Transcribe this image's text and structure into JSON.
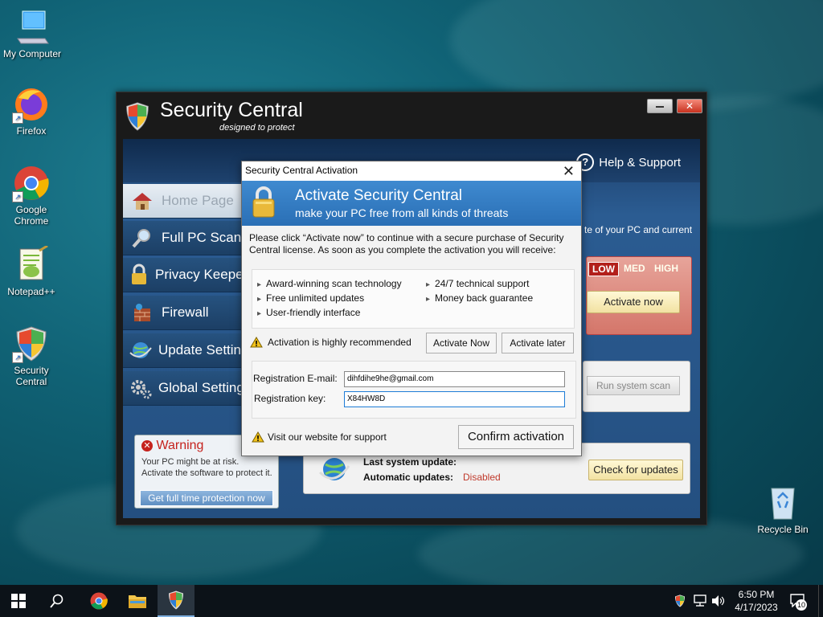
{
  "desktop": {
    "icons": [
      {
        "label": "My Computer"
      },
      {
        "label": "Firefox"
      },
      {
        "label": "Google Chrome"
      },
      {
        "label": "Notepad++"
      },
      {
        "label": "Security Central"
      },
      {
        "label": "Recycle Bin"
      }
    ]
  },
  "app": {
    "title": "Security Central",
    "subtitle": "designed to protect",
    "help": "Help & Support",
    "nav": [
      "Home Page",
      "Full PC Scan",
      "Privacy Keeper",
      "Firewall",
      "Update Settings",
      "Global Settings"
    ],
    "state_text": "te of your PC and current",
    "levels": [
      "LOW",
      "MED",
      "HIGH"
    ],
    "activate_btn": "Activate now",
    "scan_btn": "Run system scan",
    "warning": {
      "title": "Warning",
      "line1": "Your PC might be at risk.",
      "line2": "Activate the software to protect it.",
      "button": "Get full time protection now"
    },
    "updates": {
      "last_label": "Last system update:",
      "auto_label": "Automatic updates:",
      "auto_value": "Disabled",
      "check_btn": "Check for updates"
    }
  },
  "dialog": {
    "title": "Security Central Activation",
    "heading": "Activate Security Central",
    "subheading": "make your PC free from all kinds of threats",
    "intro": "Please click “Activate now” to continue with a secure purchase of Security Central license. As soon as you complete the activation you will receive:",
    "features_left": [
      "Award-winning scan technology",
      "Free unlimited updates",
      "User-friendly interface"
    ],
    "features_right": [
      "24/7 technical support",
      "Money back guarantee"
    ],
    "recommend": "Activation is highly recommended",
    "activate_now": "Activate Now",
    "activate_later": "Activate later",
    "email_label": "Registration E-mail:",
    "email_value": "dihfdihe9he@gmail.com",
    "key_label": "Registration key:",
    "key_value": "X84HW8D",
    "support": "Visit our website for support",
    "confirm": "Confirm activation"
  },
  "taskbar": {
    "time": "6:50 PM",
    "date": "4/17/2023",
    "notifications": "10"
  },
  "colors": {
    "accent": "#2a6fb5",
    "warning_red": "#c5221d",
    "disabled_red": "#c0392b"
  }
}
